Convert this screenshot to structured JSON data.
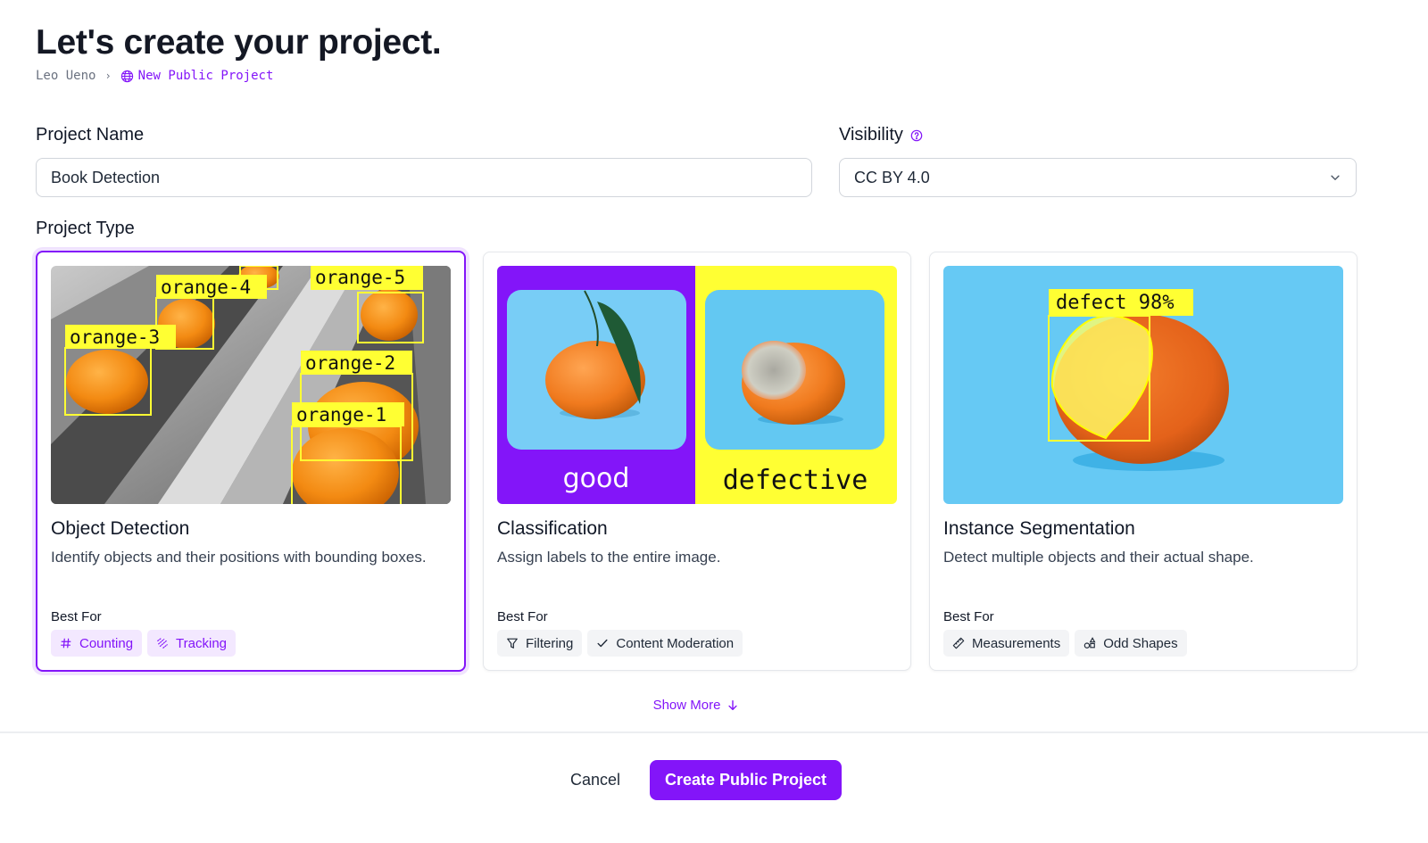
{
  "header": {
    "title": "Let's create your project.",
    "breadcrumb": {
      "owner": "Leo Ueno",
      "separator": "›",
      "current": "New Public Project",
      "current_icon": "globe-icon"
    }
  },
  "form": {
    "project_name": {
      "label": "Project Name",
      "value": "Book Detection"
    },
    "visibility": {
      "label": "Visibility",
      "help_icon": "help-circle-icon",
      "selected": "CC BY 4.0"
    },
    "project_type": {
      "label": "Project Type",
      "selected_index": 0,
      "cards": [
        {
          "title": "Object Detection",
          "description": "Identify objects and their positions with bounding boxes.",
          "best_for_label": "Best For",
          "chips": [
            {
              "icon": "hash-icon",
              "label": "Counting"
            },
            {
              "icon": "tracking-icon",
              "label": "Tracking"
            }
          ],
          "image_labels": [
            "orange-1",
            "orange-2",
            "orange-3",
            "orange-4",
            "orange-5"
          ]
        },
        {
          "title": "Classification",
          "description": "Assign labels to the entire image.",
          "best_for_label": "Best For",
          "chips": [
            {
              "icon": "filter-icon",
              "label": "Filtering"
            },
            {
              "icon": "check-icon",
              "label": "Content Moderation"
            }
          ],
          "image_labels": [
            "good",
            "defective"
          ]
        },
        {
          "title": "Instance Segmentation",
          "description": "Detect multiple objects and their actual shape.",
          "best_for_label": "Best For",
          "chips": [
            {
              "icon": "ruler-icon",
              "label": "Measurements"
            },
            {
              "icon": "shapes-icon",
              "label": "Odd Shapes"
            }
          ],
          "image_labels": [
            "defect 98%"
          ]
        }
      ]
    }
  },
  "show_more": {
    "label": "Show More",
    "icon": "arrow-down-icon"
  },
  "footer": {
    "cancel_label": "Cancel",
    "create_label": "Create Public Project"
  },
  "colors": {
    "accent": "#8315f9",
    "annotation_yellow": "#ffff33",
    "sky_blue": "#66c9f4"
  }
}
